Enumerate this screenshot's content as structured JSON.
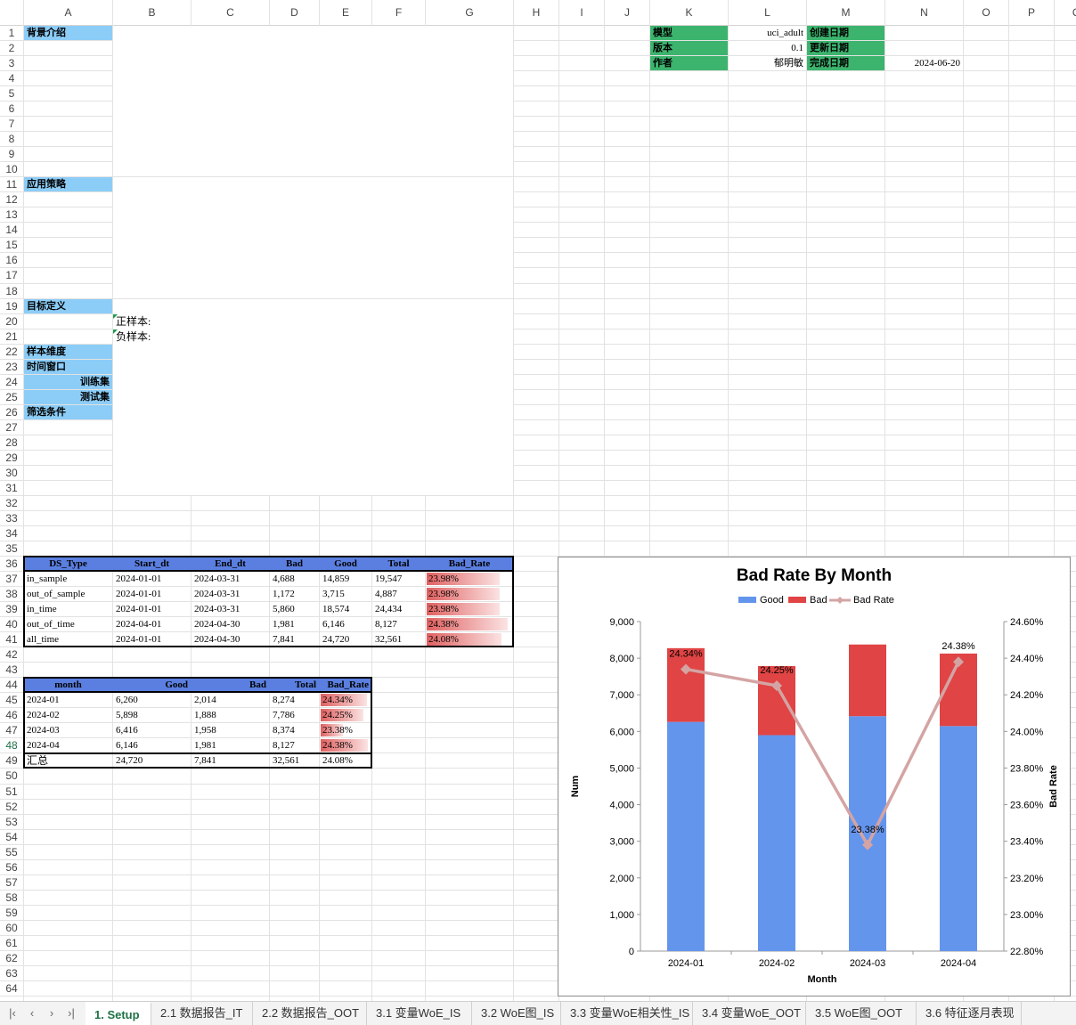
{
  "columns": [
    "A",
    "B",
    "C",
    "D",
    "E",
    "F",
    "G",
    "H",
    "I",
    "J",
    "K",
    "L",
    "M",
    "N",
    "O",
    "P",
    "Q"
  ],
  "selected_row": 48,
  "rows_visible": 64,
  "header_block": {
    "model_label": "模型",
    "model_value": "uci_adult",
    "created_label": "创建日期",
    "version_label": "版本",
    "version_value": "0.1",
    "updated_label": "更新日期",
    "author_label": "作者",
    "author_value": "郁明敏",
    "done_label": "完成日期",
    "done_value": "2024-06-20"
  },
  "sections": {
    "background": "背景介绍",
    "strategy": "应用策略",
    "target": "目标定义",
    "positive": "正样本:",
    "negative": "负样本:",
    "sample_dim": "样本维度",
    "time_window": "时间窗口",
    "train_set": "训练集",
    "test_set": "测试集",
    "filter": "筛选条件"
  },
  "table1": {
    "headers": [
      "DS_Type",
      "Start_dt",
      "End_dt",
      "Bad",
      "Good",
      "Total",
      "Bad_Rate"
    ],
    "rows": [
      [
        "in_sample",
        "2024-01-01",
        "2024-03-31",
        "4,688",
        "14,859",
        "19,547",
        "23.98%"
      ],
      [
        "out_of_sample",
        "2024-01-01",
        "2024-03-31",
        "1,172",
        "3,715",
        "4,887",
        "23.98%"
      ],
      [
        "in_time",
        "2024-01-01",
        "2024-03-31",
        "5,860",
        "18,574",
        "24,434",
        "23.98%"
      ],
      [
        "out_of_time",
        "2024-04-01",
        "2024-04-30",
        "1,981",
        "6,146",
        "8,127",
        "24.38%"
      ],
      [
        "all_time",
        "2024-01-01",
        "2024-04-30",
        "7,841",
        "24,720",
        "32,561",
        "24.08%"
      ]
    ],
    "rate_fill": [
      0.85,
      0.85,
      0.85,
      0.95,
      0.88
    ]
  },
  "table2": {
    "headers": [
      "month",
      "Good",
      "Bad",
      "Total",
      "Bad_Rate"
    ],
    "rows": [
      [
        "2024-01",
        "6,260",
        "2,014",
        "8,274",
        "24.34%"
      ],
      [
        "2024-02",
        "5,898",
        "1,888",
        "7,786",
        "24.25%"
      ],
      [
        "2024-03",
        "6,416",
        "1,958",
        "8,374",
        "23.38%"
      ],
      [
        "2024-04",
        "6,146",
        "1,981",
        "8,127",
        "24.38%"
      ]
    ],
    "rate_fill": [
      0.92,
      0.85,
      0.45,
      0.95
    ],
    "total_row": [
      "汇总",
      "24,720",
      "7,841",
      "32,561",
      "24.08%"
    ]
  },
  "colors": {
    "section_fill": "#8ccdf7",
    "header_fill": "#5b7fe0",
    "meta_fill": "#3cb46e",
    "rate_red": "#e06060",
    "good": "#6495ed",
    "bad": "#e04444",
    "line": "#d4a4a4"
  },
  "chart_data": {
    "type": "bar",
    "title": "Bad Rate By Month",
    "xlabel": "Month",
    "ylabel": "Num",
    "y2label": "Bad Rate",
    "categories": [
      "2024-01",
      "2024-02",
      "2024-03",
      "2024-04"
    ],
    "series": [
      {
        "name": "Good",
        "values": [
          6260,
          5898,
          6416,
          6146
        ]
      },
      {
        "name": "Bad",
        "values": [
          2014,
          1888,
          1958,
          1981
        ]
      }
    ],
    "line_series": {
      "name": "Bad Rate",
      "values": [
        24.34,
        24.25,
        23.38,
        24.38
      ],
      "labels": [
        "24.34%",
        "24.25%",
        "23.38%",
        "24.38%"
      ]
    },
    "ylim": [
      0,
      9000
    ],
    "y_ticks": [
      "0",
      "1,000",
      "2,000",
      "3,000",
      "4,000",
      "5,000",
      "6,000",
      "7,000",
      "8,000",
      "9,000"
    ],
    "y2lim": [
      22.8,
      24.6
    ],
    "y2_ticks": [
      "22.80%",
      "23.00%",
      "23.20%",
      "23.40%",
      "23.60%",
      "23.80%",
      "24.00%",
      "24.20%",
      "24.40%",
      "24.60%"
    ],
    "stacked": true,
    "legend": "top"
  },
  "tabs": {
    "items": [
      "1. Setup",
      "2.1 数据报告_IT",
      "2.2 数据报告_OOT",
      "3.1 变量WoE_IS",
      "3.2 WoE图_IS",
      "3.3 变量WoE相关性_IS",
      "3.4 变量WoE_OOT",
      "3.5 WoE图_OOT",
      "3.6 特征逐月表现"
    ],
    "active": 0
  }
}
